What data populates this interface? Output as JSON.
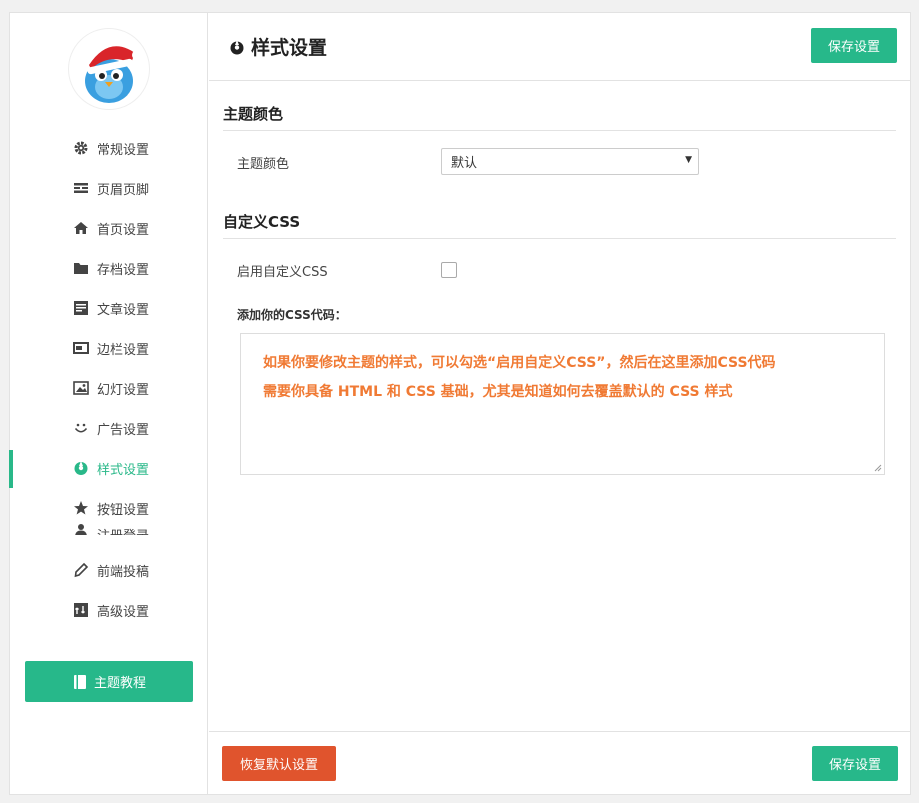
{
  "sidebar": {
    "items": [
      {
        "label": "常规设置",
        "icon": "gear-icon"
      },
      {
        "label": "页眉页脚",
        "icon": "header-footer-icon"
      },
      {
        "label": "首页设置",
        "icon": "home-icon"
      },
      {
        "label": "存档设置",
        "icon": "folder-icon"
      },
      {
        "label": "文章设置",
        "icon": "article-icon"
      },
      {
        "label": "边栏设置",
        "icon": "sidebar-icon"
      },
      {
        "label": "幻灯设置",
        "icon": "slides-icon"
      },
      {
        "label": "广告设置",
        "icon": "smile-icon"
      },
      {
        "label": "样式设置",
        "icon": "palette-icon"
      },
      {
        "label": "按钮设置",
        "icon": "star-icon"
      },
      {
        "label": "注册登录",
        "icon": "user-icon"
      },
      {
        "label": "前端投稿",
        "icon": "pencil-icon"
      },
      {
        "label": "高级设置",
        "icon": "advanced-icon"
      }
    ],
    "active_index": 8,
    "tutorial_label": "主题教程"
  },
  "header": {
    "title": "样式设置",
    "save_label": "保存设置"
  },
  "theme_color": {
    "section_title": "主题颜色",
    "field_label": "主题颜色",
    "selected": "默认"
  },
  "custom_css": {
    "section_title": "自定义CSS",
    "enable_label": "启用自定义CSS",
    "enabled": false,
    "code_label": "添加你的CSS代码：",
    "code_lines": [
      "如果你要修改主题的样式，可以勾选“启用自定义CSS”，然后在这里添加CSS代码",
      "需要你具备 HTML 和 CSS 基础，尤其是知道如何去覆盖默认的 CSS 样式"
    ]
  },
  "footer": {
    "reset_label": "恢复默认设置",
    "save_label": "保存设置"
  },
  "colors": {
    "accent": "#27b88a",
    "danger": "#e0542d",
    "hint_text": "#f07a34"
  }
}
